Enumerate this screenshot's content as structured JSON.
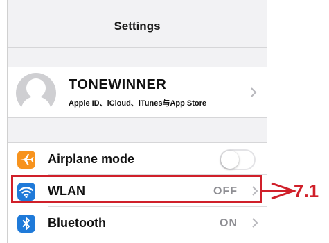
{
  "header": {
    "title": "Settings"
  },
  "profile": {
    "name": "TONEWINNER",
    "subtitle": "Apple ID、iCloud、iTunes与App Store"
  },
  "settings": [
    {
      "label": "Airplane mode",
      "icon": "airplane-icon",
      "icon_color": "#f7931e",
      "control": "toggle",
      "toggle_on": false
    },
    {
      "label": "WLAN",
      "icon": "wifi-icon",
      "icon_color": "#1f7ad9",
      "value": "OFF"
    },
    {
      "label": "Bluetooth",
      "icon": "bluetooth-icon",
      "icon_color": "#1f7ad9",
      "value": "ON"
    }
  ],
  "annotation": {
    "label": "7.1",
    "color": "#d0202a"
  }
}
